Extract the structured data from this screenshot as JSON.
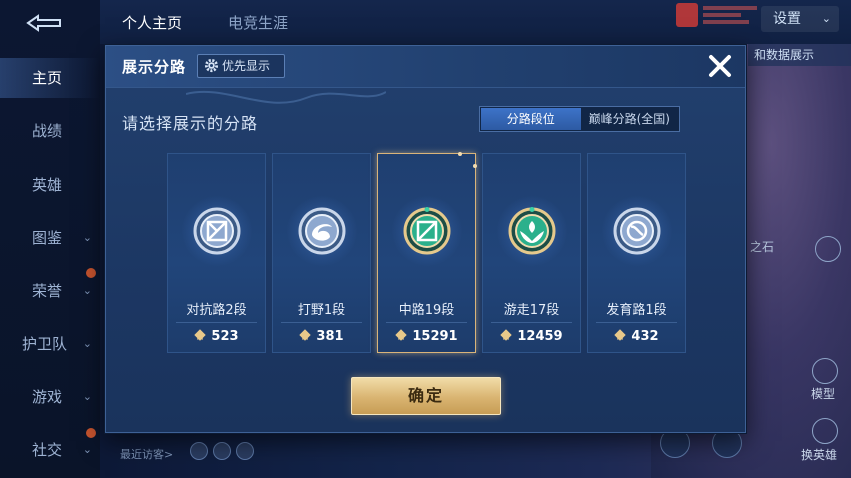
{
  "background": {
    "sidebar_items": [
      {
        "label": "主页",
        "active": true,
        "expandable": false
      },
      {
        "label": "战绩",
        "active": false,
        "expandable": false
      },
      {
        "label": "英雄",
        "active": false,
        "expandable": false
      },
      {
        "label": "图鉴",
        "active": false,
        "expandable": true
      },
      {
        "label": "荣誉",
        "active": false,
        "expandable": true
      },
      {
        "label": "护卫队",
        "active": false,
        "expandable": true
      },
      {
        "label": "游戏",
        "active": false,
        "expandable": true
      },
      {
        "label": "社交",
        "active": false,
        "expandable": true
      }
    ],
    "tabs": [
      {
        "label": "个人主页"
      },
      {
        "label": "电竞生涯"
      }
    ],
    "settings_label": "设置",
    "data_display_label": "和数据展示",
    "right_partial_label": "之石",
    "model_label": "模型",
    "change_hero_label": "换英雄",
    "recent_visitors_label": "最近访客>"
  },
  "modal": {
    "title": "展示分路",
    "priority_button": "优先显示",
    "subtitle": "请选择展示的分路",
    "segments": [
      {
        "label": "分路段位",
        "selected": true
      },
      {
        "label": "巅峰分路(全国)",
        "selected": false
      }
    ],
    "lanes": [
      {
        "name": "对抗路2段",
        "score": "523",
        "icon": "clash-lane-emblem-icon",
        "selected": false
      },
      {
        "name": "打野1段",
        "score": "381",
        "icon": "jungle-emblem-icon",
        "selected": false
      },
      {
        "name": "中路19段",
        "score": "15291",
        "icon": "mid-lane-emblem-icon",
        "selected": true
      },
      {
        "name": "游走17段",
        "score": "12459",
        "icon": "roam-emblem-icon",
        "selected": false
      },
      {
        "name": "发育路1段",
        "score": "432",
        "icon": "farm-lane-emblem-icon",
        "selected": false
      }
    ],
    "confirm_label": "确定"
  },
  "colors": {
    "accent_blue": "#3d73c8",
    "gold": "#d9b471",
    "selected_border": "#d9b47a"
  }
}
